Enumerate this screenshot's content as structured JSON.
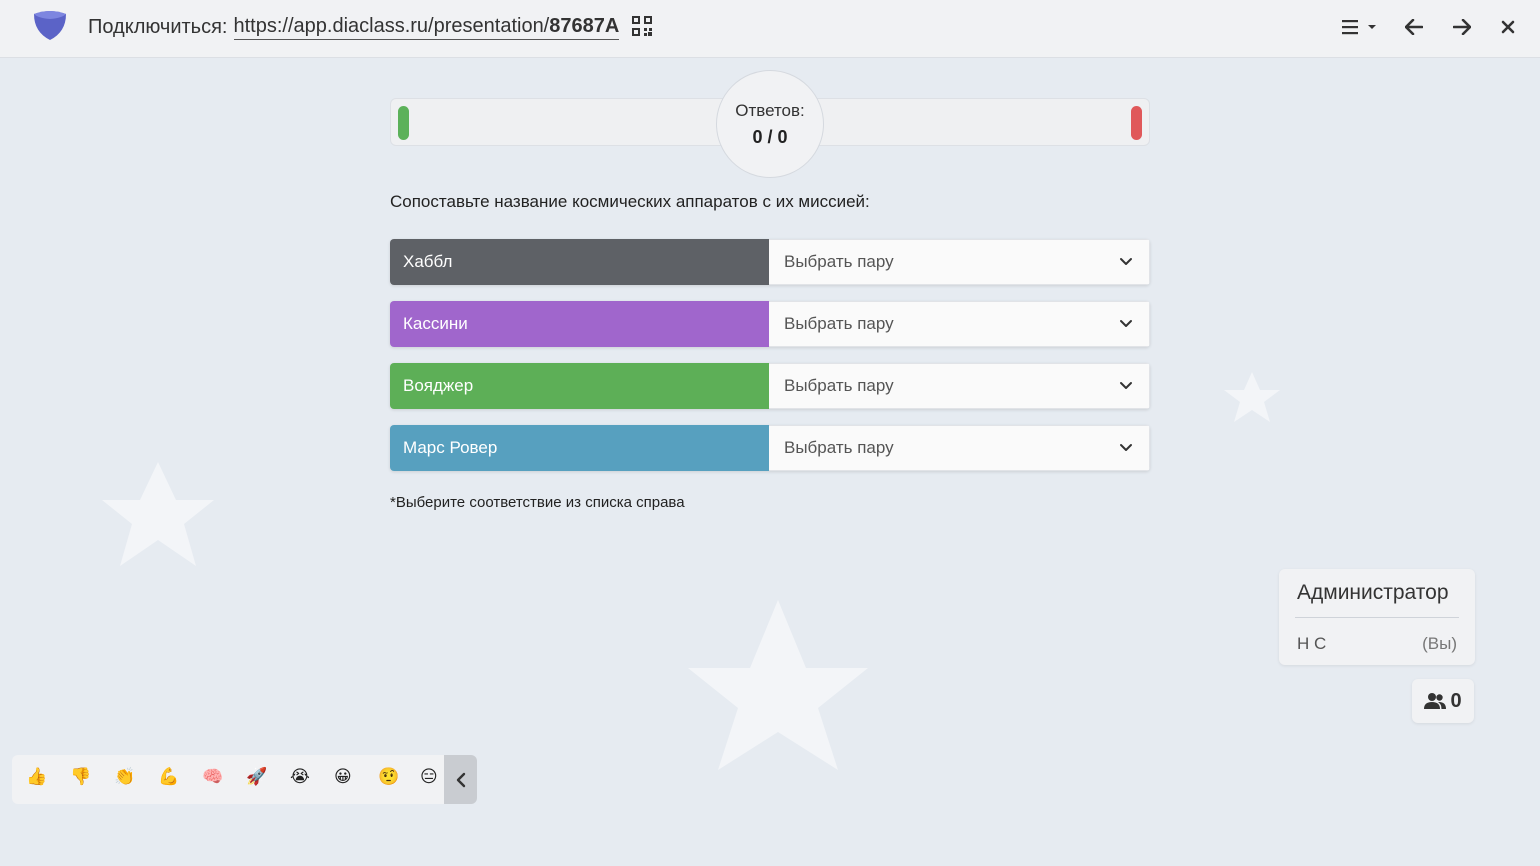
{
  "header": {
    "connect_label": "Подключиться:",
    "url_base": "https://app.diaclass.ru/presentation/",
    "url_code": "87687A",
    "icons": [
      "logo-icon",
      "qr-code-icon",
      "menu-icon",
      "arrow-left-icon",
      "arrow-right-icon",
      "close-icon"
    ]
  },
  "progress": {
    "answers_label": "Ответов:",
    "answers_value": "0 / 0",
    "colors": {
      "correct": "#5cb15a",
      "wrong": "#e0585a"
    }
  },
  "question": "Сопоставьте название космических аппаратов с их миссией:",
  "pairs": [
    {
      "label": "Хаббл",
      "color": "#5e6166",
      "select": "Выбрать пару"
    },
    {
      "label": "Кассини",
      "color": "#a066cc",
      "select": "Выбрать пару"
    },
    {
      "label": "Вояджер",
      "color": "#5daf57",
      "select": "Выбрать пару"
    },
    {
      "label": "Марс Ровер",
      "color": "#57a0bf",
      "select": "Выбрать пару"
    }
  ],
  "hint": "*Выберите соответствие из списка справа",
  "admin": {
    "title": "Администратор",
    "name": "Н С",
    "you": "(Вы)"
  },
  "users": {
    "count": "0"
  },
  "reactions": [
    "👍",
    "👎",
    "👏",
    "💪",
    "🧠",
    "🚀",
    "😭",
    "😀",
    "🤨",
    "😑"
  ]
}
